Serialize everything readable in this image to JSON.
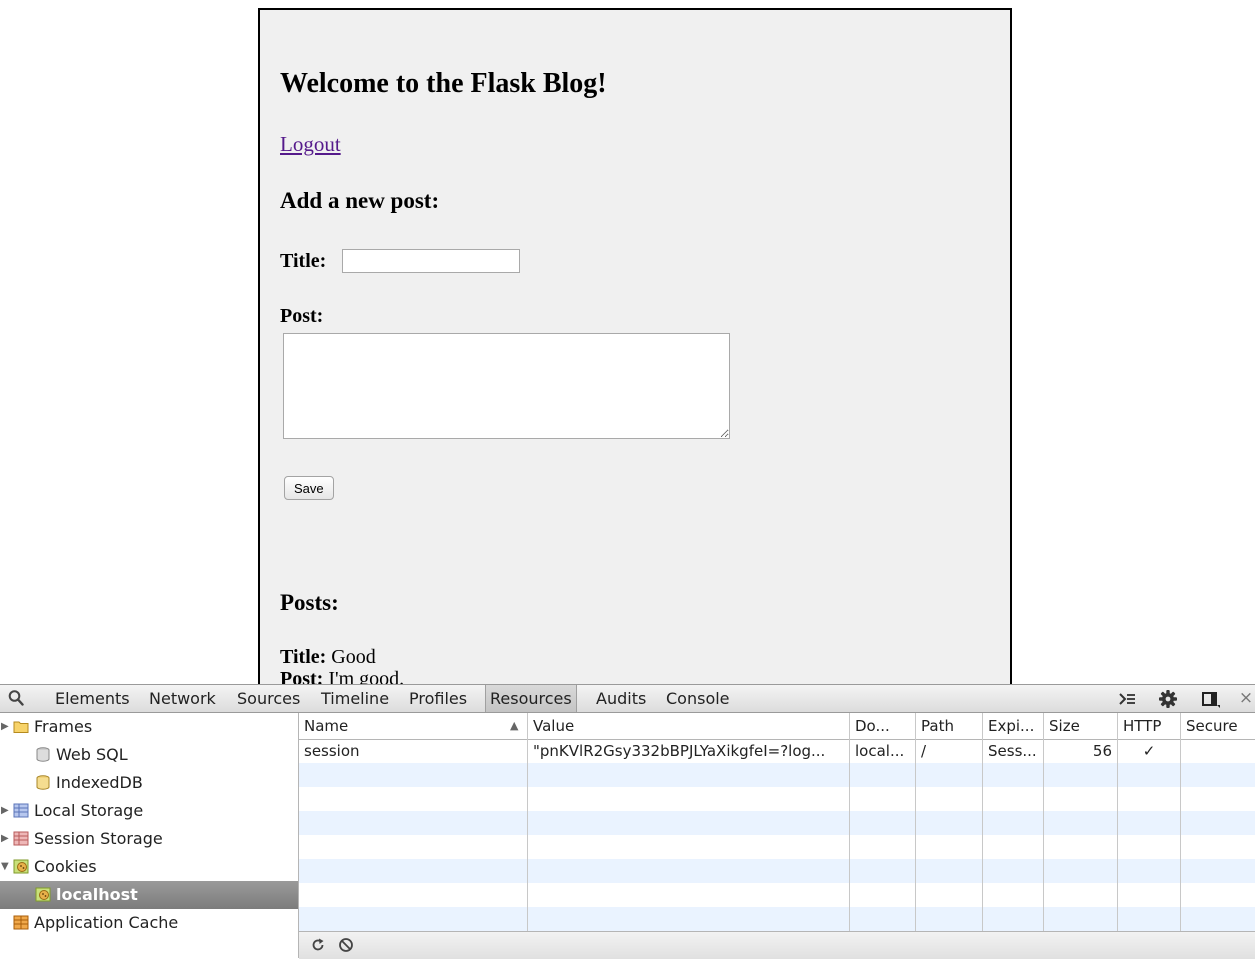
{
  "page": {
    "heading": "Welcome to the Flask Blog!",
    "logout_link": "Logout",
    "add_heading": "Add a new post:",
    "title_label": "Title:",
    "title_value": "",
    "post_label": "Post:",
    "post_value": "",
    "save_label": "Save",
    "posts_heading": "Posts:",
    "posts": [
      {
        "title_label": "Title:",
        "title": "Good",
        "post_label": "Post:",
        "post": "I'm good."
      }
    ]
  },
  "devtools": {
    "tabs": [
      "Elements",
      "Network",
      "Sources",
      "Timeline",
      "Profiles",
      "Resources",
      "Audits",
      "Console"
    ],
    "active_tab": "Resources",
    "right_icons": [
      "console-drawer-icon",
      "gear-icon",
      "dock-icon",
      "close-icon"
    ],
    "close_glyph": "×",
    "sidebar": [
      {
        "label": "Frames",
        "icon": "folder-icon",
        "expandable": true,
        "expanded": false
      },
      {
        "label": "Web SQL",
        "icon": "database-icon",
        "expandable": false
      },
      {
        "label": "IndexedDB",
        "icon": "database-icon",
        "expandable": false
      },
      {
        "label": "Local Storage",
        "icon": "local-storage-icon",
        "expandable": true,
        "expanded": false
      },
      {
        "label": "Session Storage",
        "icon": "session-storage-icon",
        "expandable": true,
        "expanded": false
      },
      {
        "label": "Cookies",
        "icon": "cookie-icon",
        "expandable": true,
        "expanded": true
      },
      {
        "label": "localhost",
        "icon": "cookie-icon",
        "expandable": false,
        "selected": true
      },
      {
        "label": "Application Cache",
        "icon": "app-cache-icon",
        "expandable": false
      }
    ],
    "cookie_table": {
      "sort_indicator": "▲",
      "columns": [
        "Name",
        "Value",
        "Do...",
        "Path",
        "Expi...",
        "Size",
        "HTTP",
        "Secure"
      ],
      "rows": [
        [
          "session",
          "\"pnKVlR2Gsy332bBPJLYaXikgfeI=?log...",
          "local...",
          "/",
          "Sess...",
          "56",
          "✓",
          ""
        ]
      ]
    },
    "status_icons": [
      "refresh-icon",
      "clear-icon"
    ],
    "colors": {
      "row_stripe": "#eaf3ff",
      "selected_item": "#8a8a8a"
    }
  }
}
